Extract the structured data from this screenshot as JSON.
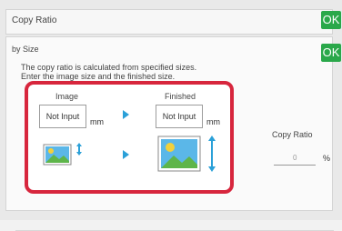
{
  "window": {
    "title": "Copy Ratio",
    "ok_label": "OK"
  },
  "panel": {
    "subtitle": "by Size",
    "ok_label": "OK",
    "description_line1": "The copy ratio is calculated from specified sizes.",
    "description_line2": "Enter the image size and the finished size."
  },
  "image_col": {
    "label": "Image",
    "input_value": "Not Input",
    "unit": "mm"
  },
  "finished_col": {
    "label": "Finished",
    "input_value": "Not Input",
    "unit": "mm"
  },
  "copy_ratio": {
    "label": "Copy Ratio",
    "value": "0",
    "unit": "%"
  },
  "colors": {
    "ok_green": "#2aa84a",
    "highlight_red": "#d7263d",
    "arrow_blue": "#2aa0d8"
  }
}
